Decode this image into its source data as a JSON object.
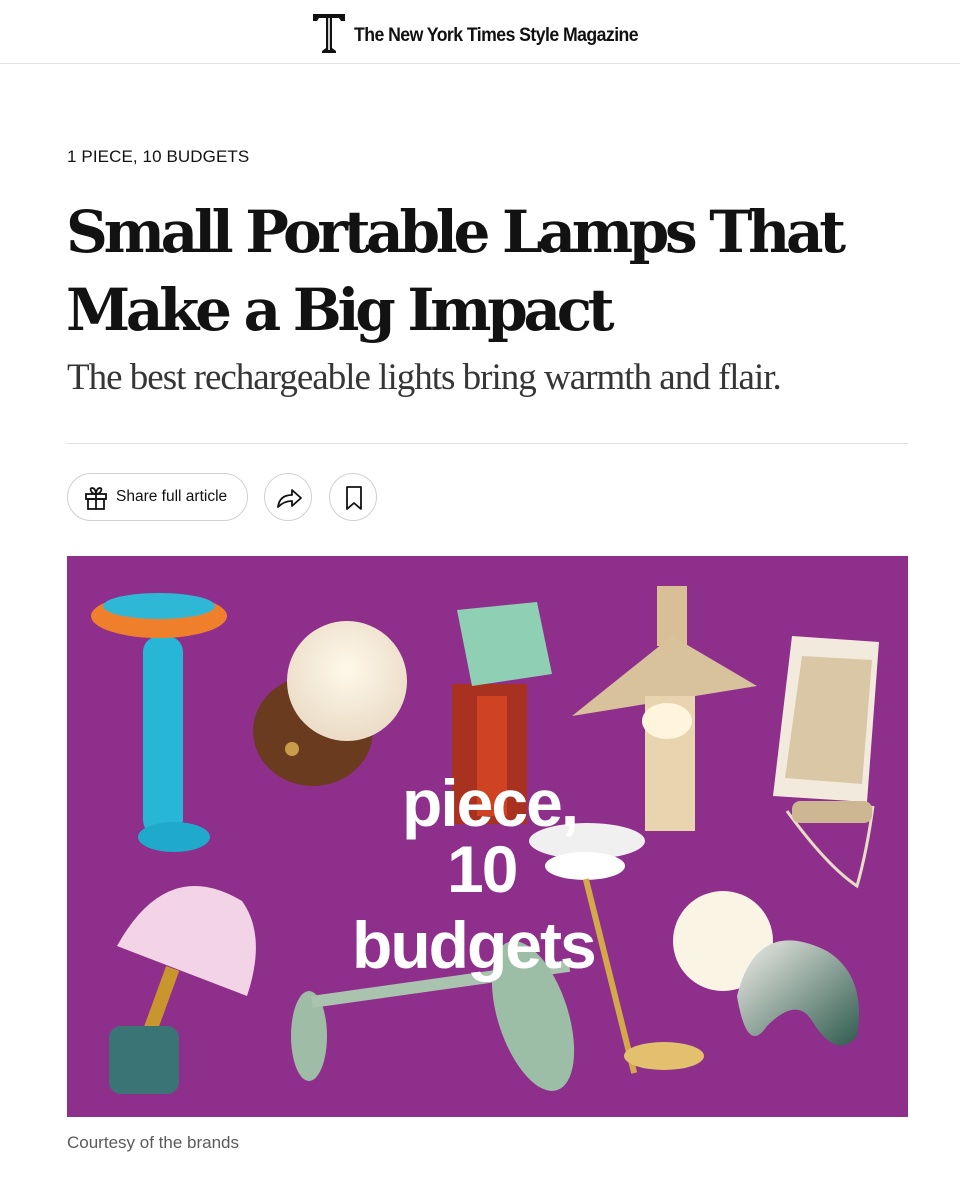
{
  "masthead": {
    "title": "The New York Times Style Magazine",
    "logo_icon": "t-magazine-logo"
  },
  "article": {
    "kicker": "1 PIECE, 10 BUDGETS",
    "headline_line1": "Small Portable Lamps That",
    "headline_line2": "Make a Big Impact",
    "subhead": "The best rechargeable lights bring warmth and flair."
  },
  "actions": {
    "share_label": "Share full article",
    "share_icon": "gift-icon",
    "forward_icon": "share-arrow-icon",
    "save_icon": "bookmark-icon"
  },
  "hero": {
    "overlay_lines": [
      "piece,",
      "10",
      "budgets"
    ],
    "background_color": "#8e2f8c",
    "caption": "Courtesy of the brands"
  }
}
